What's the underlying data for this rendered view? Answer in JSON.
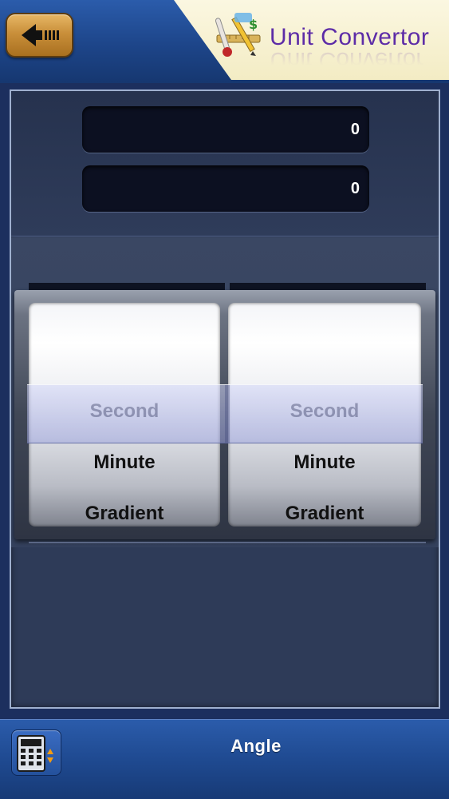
{
  "header": {
    "app_title": "Unit Convertor",
    "back_icon": "back-arrow-icon",
    "logo_icon": "unit-convertor-logo-icon"
  },
  "converter": {
    "input_value": "0",
    "output_value": "0"
  },
  "picker": {
    "from_units": [
      "Second",
      "Minute",
      "Gradient"
    ],
    "to_units": [
      "Second",
      "Minute",
      "Gradient"
    ],
    "from_selected": "Second",
    "to_selected": "Second"
  },
  "footer": {
    "category_label": "Angle",
    "category_icon": "calculator-icon"
  },
  "colors": {
    "header_blue": "#1d4589",
    "banner_cream": "#f3ecc4",
    "title_purple": "#5d2ca7",
    "back_button_orange": "#c98f3a",
    "field_dark": "#0c1021",
    "selection_tint": "#9ba2dc"
  }
}
